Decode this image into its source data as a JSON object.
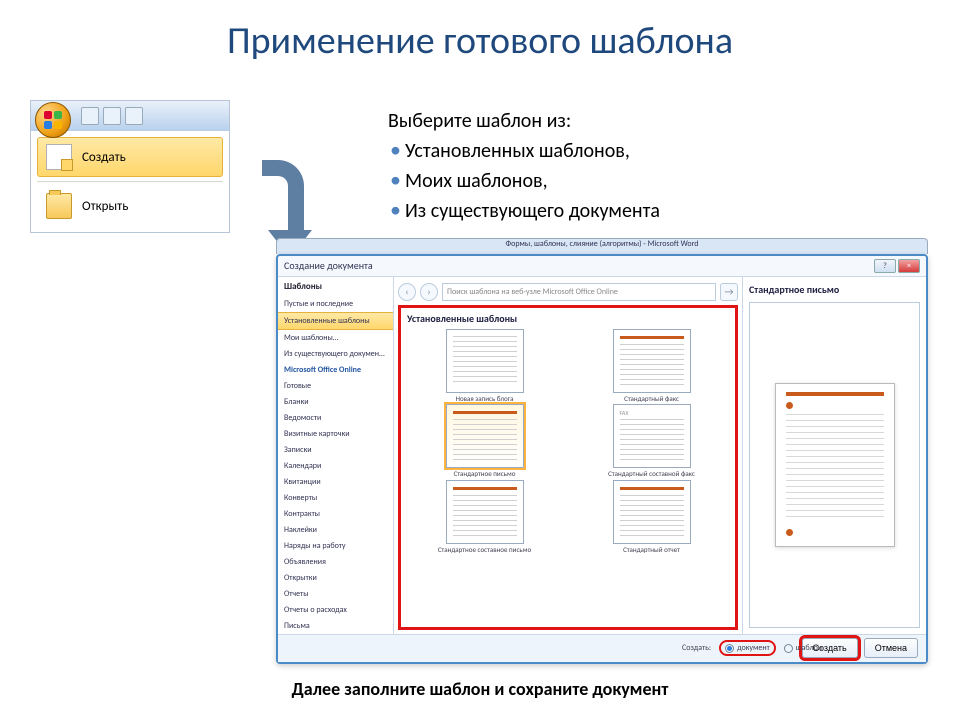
{
  "title": "Применение готового шаблона",
  "office_menu": {
    "create": "Создать",
    "open": "Открыть"
  },
  "instructions": {
    "lead": "Выберите шаблон из:",
    "items": [
      "Установленных шаблонов,",
      "Моих шаблонов,",
      "Из существующего документа"
    ]
  },
  "window_caption": "Формы, шаблоны, слияние (алгоритмы) - Microsoft Word",
  "dialog": {
    "title": "Создание документа",
    "win_help": "?",
    "win_close": "×",
    "left_header": "Шаблоны",
    "categories": [
      "Пустые и последние",
      "Установленные шаблоны",
      "Мои шаблоны…",
      "Из существующего документа…",
      "Microsoft Office Online",
      "Готовые",
      "Бланки",
      "Ведомости",
      "Визитные карточки",
      "Записки",
      "Календари",
      "Квитанции",
      "Конверты",
      "Контракты",
      "Наклейки",
      "Наряды на работу",
      "Объявления",
      "Открытки",
      "Отчеты",
      "Отчеты о расходах",
      "Письма"
    ],
    "search_placeholder": "Поиск шаблона на веб-узле Microsoft Office Online",
    "gallery_title": "Установленные шаблоны",
    "templates": [
      {
        "label": "Новая запись блога",
        "tag": ""
      },
      {
        "label": "Стандартный факс",
        "tag": ""
      },
      {
        "label": "Стандартное письмо",
        "tag": ""
      },
      {
        "label": "Стандартный составной факс",
        "tag": "FAX"
      },
      {
        "label": "Стандартное составное письмо",
        "tag": ""
      },
      {
        "label": "Стандартный отчет",
        "tag": ""
      }
    ],
    "preview_title": "Стандартное письмо",
    "radio_label": "Создать:",
    "radio_doc": "документ",
    "radio_tpl": "шаблон",
    "btn_create": "Создать",
    "btn_cancel": "Отмена"
  },
  "footer": "Далее заполните шаблон и сохраните документ"
}
